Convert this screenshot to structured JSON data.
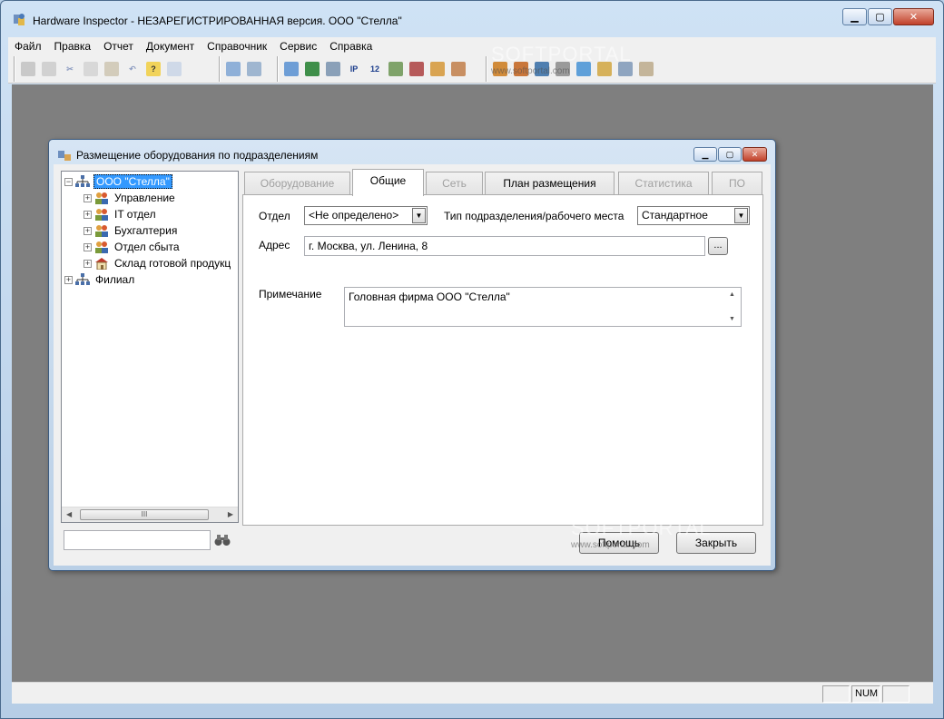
{
  "app": {
    "title": "Hardware Inspector - НЕЗАРЕГИСТРИРОВАННАЯ версия. ООО \"Стелла\""
  },
  "menu": {
    "items": [
      "Файл",
      "Правка",
      "Отчет",
      "Документ",
      "Справочник",
      "Сервис",
      "Справка"
    ]
  },
  "statusbar": {
    "num": "NUM"
  },
  "watermark": {
    "text": "SOFTPORTAL",
    "url": "www.softportal.com"
  },
  "dialog": {
    "title": "Размещение оборудования по подразделениям",
    "tree": {
      "root": "ООО \"Стелла\"",
      "children": [
        "Управление",
        "IT отдел",
        "Бухгалтерия",
        "Отдел сбыта",
        "Склад готовой продукц"
      ],
      "sibling": "Филиал",
      "scroll_thumb": "III"
    },
    "tabs": [
      "Оборудование",
      "Общие",
      "Сеть",
      "План размещения",
      "Статистика",
      "ПО"
    ],
    "form": {
      "otdel_label": "Отдел",
      "otdel_value": "<Не определено>",
      "type_label": "Тип подразделения/рабочего места",
      "type_value": "Стандартное",
      "address_label": "Адрес",
      "address_value": "г. Москва, ул. Ленина, 8",
      "browse_label": "...",
      "note_label": "Примечание",
      "note_value": "Головная фирма ООО \"Стелла\""
    },
    "buttons": {
      "help": "Помощь",
      "close": "Закрыть"
    }
  }
}
